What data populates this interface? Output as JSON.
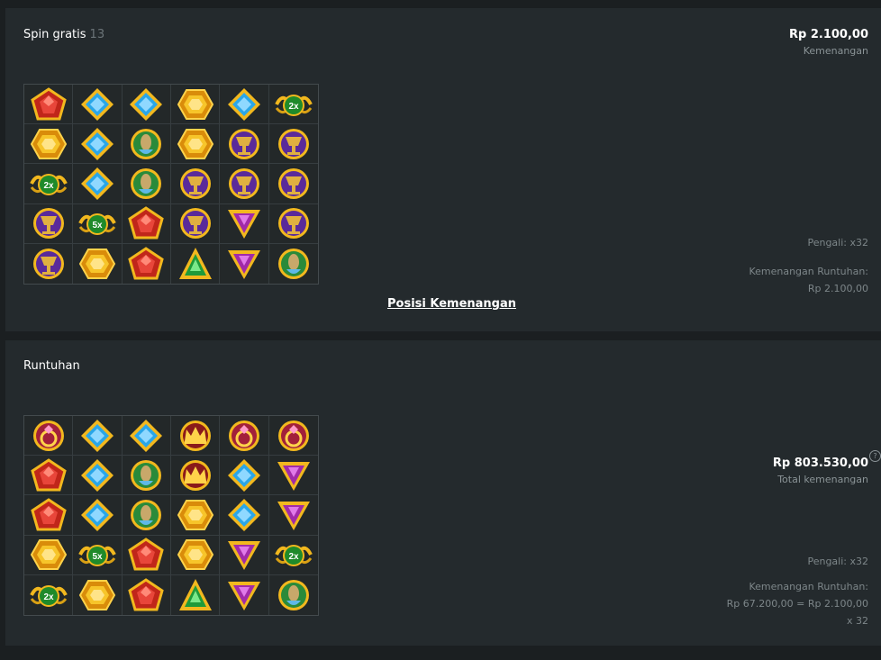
{
  "free_spin": {
    "title": "Spin gratis",
    "count": "13",
    "amount": "Rp 2.100,00",
    "amount_label": "Kemenangan",
    "multiplier": "Pengali: x32",
    "cascade_label": "Kemenangan Runtuhan:",
    "cascade_value": "Rp 2.100,00",
    "link_label": "Posisi Kemenangan",
    "grid": [
      [
        "red-pentagon",
        "blue-diamond",
        "blue-diamond",
        "yellow-hexagon",
        "blue-diamond",
        "mult-2x"
      ],
      [
        "yellow-hexagon",
        "blue-diamond",
        "green-orb",
        "yellow-hexagon",
        "purple-chalice",
        "purple-chalice"
      ],
      [
        "mult-2x",
        "blue-diamond",
        "green-orb",
        "purple-chalice",
        "purple-chalice",
        "purple-chalice"
      ],
      [
        "purple-chalice",
        "mult-5x",
        "red-pentagon",
        "purple-chalice",
        "purple-triangle",
        "purple-chalice"
      ],
      [
        "purple-chalice",
        "yellow-hexagon",
        "red-pentagon",
        "green-triangle",
        "purple-triangle",
        "green-orb"
      ]
    ]
  },
  "cascade": {
    "title": "Runtuhan",
    "amount": "Rp 803.530,00",
    "help_glyph": "?",
    "amount_label": "Total kemenangan",
    "multiplier": "Pengali: x32",
    "cascade_label": "Kemenangan Runtuhan:",
    "cascade_value": "Rp 67.200,00 = Rp 2.100,00",
    "cascade_mult": "x 32",
    "grid": [
      [
        "red-ring",
        "blue-diamond",
        "blue-diamond",
        "red-crown",
        "red-ring",
        "red-ring"
      ],
      [
        "red-pentagon",
        "blue-diamond",
        "green-orb",
        "red-crown",
        "blue-diamond",
        "purple-triangle"
      ],
      [
        "red-pentagon",
        "blue-diamond",
        "green-orb",
        "yellow-hexagon",
        "blue-diamond",
        "purple-triangle"
      ],
      [
        "yellow-hexagon",
        "mult-5x",
        "red-pentagon",
        "yellow-hexagon",
        "purple-triangle",
        "mult-2x"
      ],
      [
        "mult-2x",
        "yellow-hexagon",
        "red-pentagon",
        "green-triangle",
        "purple-triangle",
        "green-orb"
      ]
    ]
  },
  "colors": {
    "background": "#1b1f21",
    "panel": "#242a2d",
    "text_primary": "#ffffff",
    "text_muted": "#8a9396",
    "gold": "#f2b81e"
  }
}
